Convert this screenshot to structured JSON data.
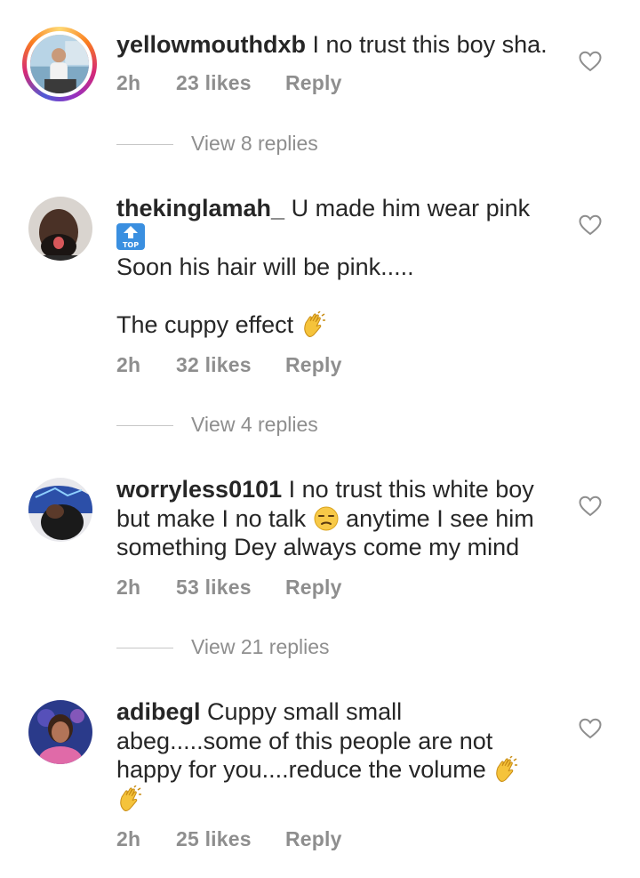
{
  "comments": [
    {
      "username": "yellowmouthdxb",
      "text_lines": [
        "I no trust this boy sha."
      ],
      "time": "2h",
      "likes": "23 likes",
      "reply_label": "Reply",
      "view_replies": "View 8 replies",
      "has_story_ring": true
    },
    {
      "username": "thekinglamah_",
      "text_lines": [
        "U made him wear pink",
        "top-emoji",
        "Soon his hair will be pink.....",
        "",
        "The cuppy effect"
      ],
      "time": "2h",
      "likes": "32 likes",
      "reply_label": "Reply",
      "view_replies": "View 4 replies",
      "has_story_ring": false
    },
    {
      "username": "worryless0101",
      "text_lines": [
        "I no trust this white boy",
        "but make I no talk",
        "anytime I see him",
        "something Dey always come my mind"
      ],
      "time": "2h",
      "likes": "53 likes",
      "reply_label": "Reply",
      "view_replies": "View 21 replies",
      "has_story_ring": false
    },
    {
      "username": "adibegl",
      "text_lines": [
        "Cuppy small small",
        "abeg.....some of this people are not",
        "happy for you....reduce the volume"
      ],
      "time": "2h",
      "likes": "25 likes",
      "reply_label": "Reply",
      "has_story_ring": false
    }
  ],
  "icons": {
    "like": "heart-outline-icon",
    "top": "top-arrow-emoji",
    "clap": "clapping-hands-emoji",
    "unamused": "unamused-face-emoji"
  },
  "colors": {
    "text": "#262626",
    "secondary": "#8e8e8e",
    "divider": "#c7c7c7"
  }
}
